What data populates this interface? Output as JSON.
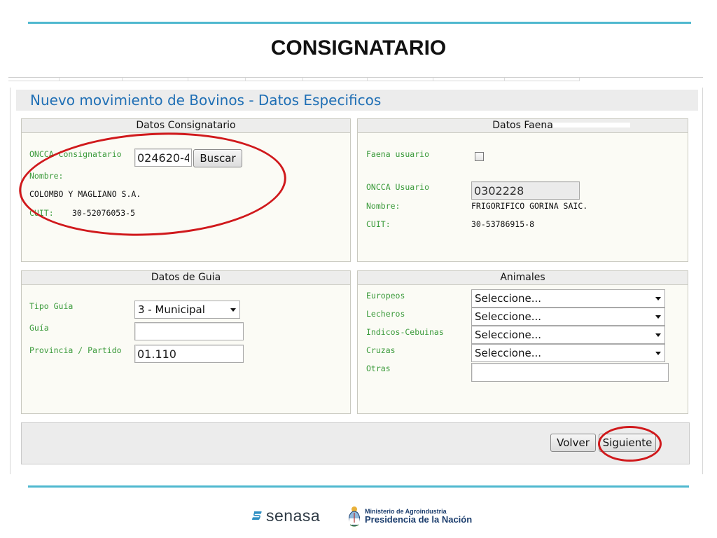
{
  "slide": {
    "title": "CONSIGNATARIO"
  },
  "app": {
    "title": "Nuevo movimiento de Bovinos - Datos Especificos"
  },
  "consignatario": {
    "header": "Datos Consignatario",
    "oncca_label": "ONCCA Consignatario",
    "oncca_value": "024620-4",
    "buscar_label": "Buscar",
    "nombre_label": "Nombre:",
    "nombre_value": "COLOMBO Y MAGLIANO S.A.",
    "cuit_label": "CUIT:",
    "cuit_value": "30-52076053-5"
  },
  "faena": {
    "header": "Datos Faena",
    "usuario_label": "Faena usuario",
    "usuario_checked": false,
    "oncca_label": "ONCCA Usuario",
    "oncca_value": "0302228",
    "nombre_label": "Nombre:",
    "nombre_value": "FRIGORIFICO GORINA SAIC.",
    "cuit_label": "CUIT:",
    "cuit_value": "30-53786915-8"
  },
  "guia": {
    "header": "Datos de Guia",
    "tipo_label": "Tipo Guía",
    "tipo_value": "3 - Municipal",
    "guia_label": "Guía",
    "guia_value": "",
    "provincia_label": "Provincia / Partido",
    "provincia_value": "01.110"
  },
  "animales": {
    "header": "Animales",
    "rows": [
      {
        "label": "Europeos",
        "value": "Seleccione..."
      },
      {
        "label": "Lecheros",
        "value": "Seleccione..."
      },
      {
        "label": "Indicos-Cebuinas",
        "value": "Seleccione..."
      },
      {
        "label": "Cruzas",
        "value": "Seleccione..."
      }
    ],
    "otras_label": "Otras",
    "otras_value": ""
  },
  "actions": {
    "volver_label": "Volver",
    "siguiente_label": "Siguiente"
  },
  "logos": {
    "senasa_text": "senasa",
    "ministerio_line1": "Ministerio de Agroindustria",
    "ministerio_line2": "Presidencia de la Nación"
  },
  "colors": {
    "accent_rule": "#4fb8cf",
    "app_title": "#1f6fb5",
    "field_label": "#3a9a3a",
    "annotation": "#d0191c"
  }
}
